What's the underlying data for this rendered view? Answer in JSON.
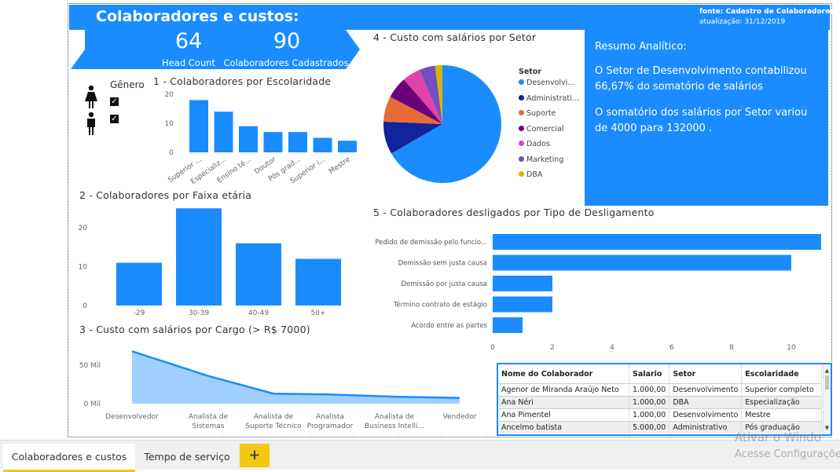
{
  "header": {
    "title": "Colaboradores e custos:",
    "source": "fonte: Cadastro de Colaboradores",
    "updated": "atualização: 31/12/2019"
  },
  "kpis": [
    {
      "value": "64",
      "label": "Head Count"
    },
    {
      "value": "90",
      "label": "Colaboradores Cadastrados"
    }
  ],
  "gender": {
    "title": "Gênero",
    "items": [
      {
        "name": "female",
        "checked": true
      },
      {
        "name": "male",
        "checked": true
      }
    ]
  },
  "summary": {
    "title": "Resumo Analítico:",
    "lines": [
      "O Setor de Desenvolvimento contabilizou 66,67% do somatório de salários",
      "O somatório dos salários por Setor variou de 4000 para 132000 ."
    ]
  },
  "colors": {
    "primary": "#1a8cff",
    "dark_blue": "#12239e",
    "orange": "#e66c37",
    "purple_dark": "#6b007b",
    "pink": "#e044a7",
    "violet": "#744ec2",
    "yellow": "#d9b300"
  },
  "chart_data": [
    {
      "id": "escolaridade",
      "type": "bar",
      "title": "1 - Colaboradores por Escolaridade",
      "categories": [
        "Superior ...",
        "Especializ...",
        "Ensino té...",
        "Doutor",
        "Pós grad...",
        "Superior i...",
        "Mestre"
      ],
      "values": [
        18,
        14,
        9,
        7,
        7,
        5,
        4
      ],
      "yticks": [
        "20",
        "10",
        "0"
      ],
      "ylim": [
        0,
        20
      ]
    },
    {
      "id": "faixa_etaria",
      "type": "bar",
      "title": "2 - Colaboradores por Faixa etária",
      "categories": [
        "-29",
        "30-39",
        "40-49",
        "50+"
      ],
      "values": [
        11,
        25,
        16,
        12
      ],
      "yticks": [
        "20",
        "10",
        "0"
      ],
      "ylim": [
        0,
        20
      ]
    },
    {
      "id": "cargo",
      "type": "area",
      "title": "3 - Custo com salários por Cargo (> R$ 7000)",
      "categories": [
        "Desenvolvedor",
        "Analista de Sistemas",
        "Analista de Suporte Técnico",
        "Analista Programador",
        "Analista de Business Intelli...",
        "Vendedor"
      ],
      "values": [
        68000,
        36000,
        13000,
        12000,
        9000,
        7500
      ],
      "yticks": [
        "50 Mil",
        "0 Mil"
      ],
      "ylim": [
        0,
        50000
      ]
    },
    {
      "id": "setor",
      "type": "pie",
      "title": "4 - Custo com salários por Setor",
      "legend_title": "Setor",
      "categories": [
        "Desenvolvi...",
        "Administrati...",
        "Suporte",
        "Comercial",
        "Dados",
        "Marketing",
        "DBA"
      ],
      "values": [
        66.67,
        9.0,
        7.0,
        6.0,
        5.0,
        4.33,
        2.0
      ]
    },
    {
      "id": "desligamento",
      "type": "bar",
      "orientation": "horizontal",
      "title": "5 - Colaboradores desligados por Tipo de Desligamento",
      "categories": [
        "Pedido de demissão pelo funcio...",
        "Demissão sem justa causa",
        "Demissão por justa causa",
        "Término contrato de estágio",
        "Acordo entre as partes"
      ],
      "values": [
        11,
        10,
        2,
        2,
        1
      ],
      "xticks": [
        "0",
        "2",
        "4",
        "6",
        "8",
        "10"
      ],
      "xlim": [
        0,
        11
      ]
    },
    {
      "id": "colaboradores_tabela",
      "type": "table",
      "columns": [
        "Nome do Colaborador",
        "Salario",
        "Setor",
        "Escolaridade"
      ],
      "rows": [
        [
          "Agenor de Miranda Araújo Neto",
          "1.000,00",
          "Desenvolvimento",
          "Superior completo"
        ],
        [
          "Ana Néri",
          "1.000,00",
          "DBA",
          "Especialização"
        ],
        [
          "Ana Pimentel",
          "1.000,00",
          "Desenvolvimento",
          "Mestre"
        ],
        [
          "Ancelmo batista",
          "5.000,00",
          "Administrativo",
          "Pós graduação"
        ]
      ]
    }
  ],
  "tabs": {
    "items": [
      "Colaboradores e custos",
      "Tempo de serviço"
    ],
    "add_label": "+"
  },
  "watermark": {
    "line1": "Ativar o Windo",
    "line2": "Acesse Configuraçõe"
  }
}
